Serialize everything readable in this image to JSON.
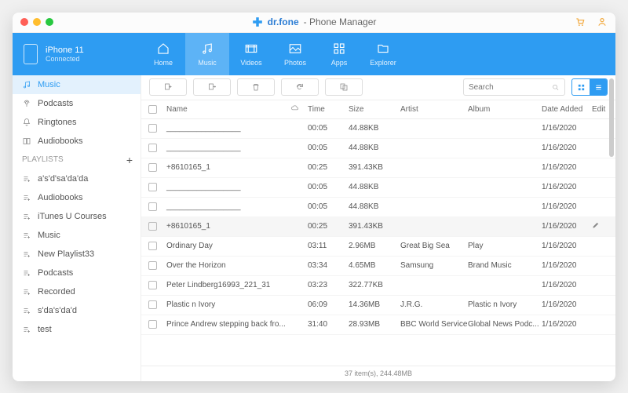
{
  "titlebar": {
    "brand": "dr.fone",
    "subtitle": "- Phone Manager"
  },
  "device": {
    "name": "iPhone 11",
    "status": "Connected"
  },
  "nav": [
    {
      "label": "Home"
    },
    {
      "label": "Music"
    },
    {
      "label": "Videos"
    },
    {
      "label": "Photos"
    },
    {
      "label": "Apps"
    },
    {
      "label": "Explorer"
    }
  ],
  "sidebar": {
    "items": [
      {
        "label": "Music"
      },
      {
        "label": "Podcasts"
      },
      {
        "label": "Ringtones"
      },
      {
        "label": "Audiobooks"
      }
    ],
    "playlists_header": "PLAYLISTS",
    "playlists": [
      {
        "label": "a's'd'sa'da'da"
      },
      {
        "label": "Audiobooks"
      },
      {
        "label": "iTunes U Courses"
      },
      {
        "label": "Music"
      },
      {
        "label": "New Playlist33"
      },
      {
        "label": "Podcasts"
      },
      {
        "label": "Recorded"
      },
      {
        "label": "s'da's'da'd"
      },
      {
        "label": "test"
      }
    ]
  },
  "search": {
    "placeholder": "Search"
  },
  "columns": {
    "name": "Name",
    "time": "Time",
    "size": "Size",
    "artist": "Artist",
    "album": "Album",
    "date": "Date Added",
    "edit": "Edit"
  },
  "rows": [
    {
      "name": "_________________",
      "time": "00:05",
      "size": "44.88KB",
      "artist": "",
      "album": "",
      "date": "1/16/2020"
    },
    {
      "name": "_________________",
      "time": "00:05",
      "size": "44.88KB",
      "artist": "",
      "album": "",
      "date": "1/16/2020"
    },
    {
      "name": "+8610165_1",
      "time": "00:25",
      "size": "391.43KB",
      "artist": "",
      "album": "",
      "date": "1/16/2020"
    },
    {
      "name": "_________________",
      "time": "00:05",
      "size": "44.88KB",
      "artist": "",
      "album": "",
      "date": "1/16/2020"
    },
    {
      "name": "_________________",
      "time": "00:05",
      "size": "44.88KB",
      "artist": "",
      "album": "",
      "date": "1/16/2020"
    },
    {
      "name": "+8610165_1",
      "time": "00:25",
      "size": "391.43KB",
      "artist": "",
      "album": "",
      "date": "1/16/2020",
      "hover": true
    },
    {
      "name": "Ordinary Day",
      "time": "03:11",
      "size": "2.96MB",
      "artist": "Great Big Sea",
      "album": "Play",
      "date": "1/16/2020"
    },
    {
      "name": "Over the Horizon",
      "time": "03:34",
      "size": "4.65MB",
      "artist": "Samsung",
      "album": "Brand Music",
      "date": "1/16/2020"
    },
    {
      "name": "Peter Lindberg16993_221_31",
      "time": "03:23",
      "size": "322.77KB",
      "artist": "",
      "album": "",
      "date": "1/16/2020"
    },
    {
      "name": "Plastic n Ivory",
      "time": "06:09",
      "size": "14.36MB",
      "artist": "J.R.G.",
      "album": "Plastic n Ivory",
      "date": "1/16/2020"
    },
    {
      "name": "Prince Andrew stepping back fro...",
      "time": "31:40",
      "size": "28.93MB",
      "artist": "BBC World Service",
      "album": "Global News Podc...",
      "date": "1/16/2020"
    }
  ],
  "status": "37 item(s), 244.48MB"
}
